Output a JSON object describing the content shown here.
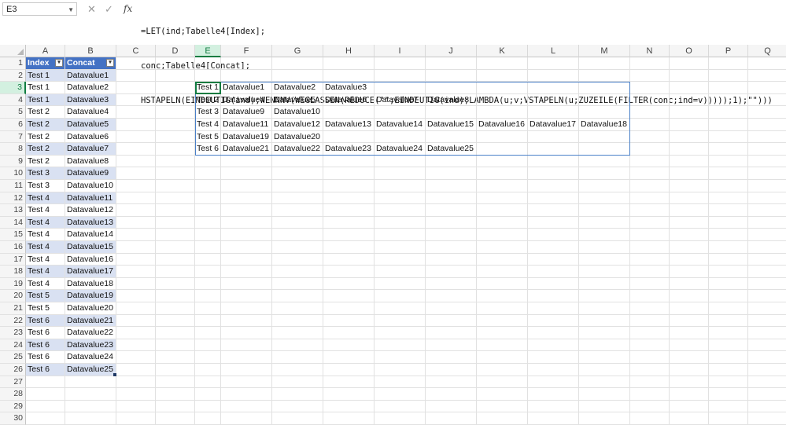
{
  "namebox": {
    "value": "E3"
  },
  "formula_bar": {
    "fx_label": "fx",
    "lines": [
      "=LET(ind;Tabelle4[Index];",
      "conc;Tabelle4[Concat];",
      "HSTAPELN(EINDEUTIG(ind);WENNNV(WEGLASSEN(REDUCE(\"\";EINDEUTIG(ind);LAMBDA(u;v;VSTAPELN(u;ZUZEILE(FILTER(conc;ind=v)))));1);\"\")))"
    ]
  },
  "columns": [
    "A",
    "B",
    "C",
    "D",
    "E",
    "F",
    "G",
    "H",
    "I",
    "J",
    "K",
    "L",
    "M",
    "N",
    "O",
    "P",
    "Q"
  ],
  "rows": [
    "1",
    "2",
    "3",
    "4",
    "5",
    "6",
    "7",
    "8",
    "9",
    "10",
    "11",
    "12",
    "13",
    "14",
    "15",
    "16",
    "17",
    "18",
    "19",
    "20",
    "21",
    "22",
    "23",
    "24",
    "25",
    "26",
    "27",
    "28",
    "29",
    "30"
  ],
  "selected": {
    "column": "E",
    "row": "3"
  },
  "table": {
    "headers": [
      "Index",
      "Concat"
    ],
    "rows": [
      [
        "Test 1",
        "Datavalue1"
      ],
      [
        "Test 1",
        "Datavalue2"
      ],
      [
        "Test 1",
        "Datavalue3"
      ],
      [
        "Test 2",
        "Datavalue4"
      ],
      [
        "Test 2",
        "Datavalue5"
      ],
      [
        "Test 2",
        "Datavalue6"
      ],
      [
        "Test 2",
        "Datavalue7"
      ],
      [
        "Test 2",
        "Datavalue8"
      ],
      [
        "Test 3",
        "Datavalue9"
      ],
      [
        "Test 3",
        "Datavalue10"
      ],
      [
        "Test 4",
        "Datavalue11"
      ],
      [
        "Test 4",
        "Datavalue12"
      ],
      [
        "Test 4",
        "Datavalue13"
      ],
      [
        "Test 4",
        "Datavalue14"
      ],
      [
        "Test 4",
        "Datavalue15"
      ],
      [
        "Test 4",
        "Datavalue16"
      ],
      [
        "Test 4",
        "Datavalue17"
      ],
      [
        "Test 4",
        "Datavalue18"
      ],
      [
        "Test 5",
        "Datavalue19"
      ],
      [
        "Test 5",
        "Datavalue20"
      ],
      [
        "Test 6",
        "Datavalue21"
      ],
      [
        "Test 6",
        "Datavalue22"
      ],
      [
        "Test 6",
        "Datavalue23"
      ],
      [
        "Test 6",
        "Datavalue24"
      ],
      [
        "Test 6",
        "Datavalue25"
      ]
    ]
  },
  "spill": {
    "rows": [
      [
        "Test 1",
        "Datavalue1",
        "Datavalue2",
        "Datavalue3",
        "",
        "",
        "",
        "",
        ""
      ],
      [
        "Test 2",
        "Datavalue4",
        "Datavalue5",
        "Datavalue6",
        "Datavalue7",
        "Datavalue8",
        "",
        "",
        ""
      ],
      [
        "Test 3",
        "Datavalue9",
        "Datavalue10",
        "",
        "",
        "",
        "",
        "",
        ""
      ],
      [
        "Test 4",
        "Datavalue11",
        "Datavalue12",
        "Datavalue13",
        "Datavalue14",
        "Datavalue15",
        "Datavalue16",
        "Datavalue17",
        "Datavalue18"
      ],
      [
        "Test 5",
        "Datavalue19",
        "Datavalue20",
        "",
        "",
        "",
        "",
        "",
        ""
      ],
      [
        "Test 6",
        "Datavalue21",
        "Datavalue22",
        "Datavalue23",
        "Datavalue24",
        "Datavalue25",
        "",
        "",
        ""
      ]
    ]
  }
}
